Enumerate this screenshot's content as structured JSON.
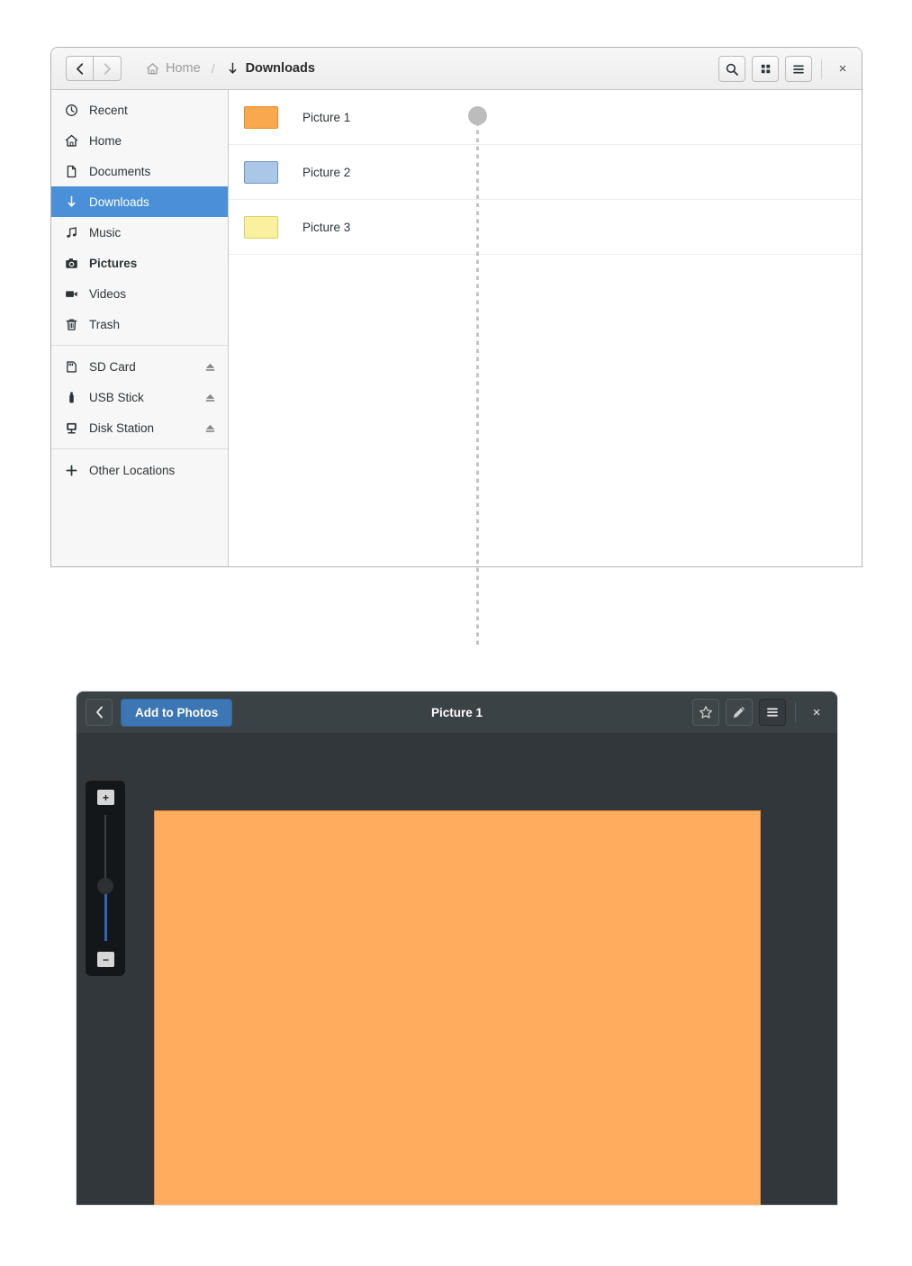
{
  "file_manager": {
    "nav": {
      "back_icon": "chevron-left-icon",
      "forward_icon": "chevron-right-icon",
      "back_label": "‹",
      "forward_label": "›"
    },
    "breadcrumb": [
      {
        "label": "Home",
        "icon": "home-icon",
        "active": false
      },
      {
        "label": "Downloads",
        "icon": "download-icon",
        "active": true
      }
    ],
    "breadcrumb_separator": "/",
    "header_buttons": [
      {
        "name": "search-button",
        "icon": "search-icon"
      },
      {
        "name": "grid-view-button",
        "icon": "grid-icon"
      },
      {
        "name": "menu-button",
        "icon": "hamburger-icon"
      }
    ],
    "close_label": "×",
    "sidebar": {
      "items": [
        {
          "label": "Recent",
          "icon": "clock-icon",
          "selected": false,
          "bold": false,
          "eject": false
        },
        {
          "label": "Home",
          "icon": "home-icon",
          "selected": false,
          "bold": false,
          "eject": false
        },
        {
          "label": "Documents",
          "icon": "document-icon",
          "selected": false,
          "bold": false,
          "eject": false
        },
        {
          "label": "Downloads",
          "icon": "download-icon",
          "selected": true,
          "bold": false,
          "eject": false
        },
        {
          "label": "Music",
          "icon": "music-note-icon",
          "selected": false,
          "bold": false,
          "eject": false
        },
        {
          "label": "Pictures",
          "icon": "camera-icon",
          "selected": false,
          "bold": true,
          "eject": false
        },
        {
          "label": "Videos",
          "icon": "video-camera-icon",
          "selected": false,
          "bold": false,
          "eject": false
        },
        {
          "label": "Trash",
          "icon": "trash-icon",
          "selected": false,
          "bold": false,
          "eject": false
        }
      ],
      "devices": [
        {
          "label": "SD Card",
          "icon": "sd-card-icon",
          "eject": true
        },
        {
          "label": "USB Stick",
          "icon": "usb-stick-icon",
          "eject": true
        },
        {
          "label": "Disk Station",
          "icon": "disk-station-icon",
          "eject": true
        }
      ],
      "other": {
        "label": "Other Locations",
        "icon": "plus-icon"
      },
      "selected_color": "#4a90d9"
    },
    "files": [
      {
        "name": "Picture 1",
        "color": "#f9a council",
        "swatch_fill": "#f9a84d",
        "swatch_border": "#e08a2a"
      },
      {
        "name": "Picture 2",
        "color": "#aac7e8",
        "swatch_fill": "#aac7e8",
        "swatch_border": "#6f93c4"
      },
      {
        "name": "Picture 3",
        "color": "#faf0a0",
        "swatch_fill": "#faf0a0",
        "swatch_border": "#dcd05a"
      }
    ]
  },
  "drag_indicator": {
    "name": "drag-handle",
    "line_color": "#c4c4c4",
    "dot_color": "#bcbcbc"
  },
  "viewer": {
    "back_label": "‹",
    "add_to_photos_label": "Add to Photos",
    "title": "Picture 1",
    "header_buttons": [
      {
        "name": "favorite-button",
        "icon": "star-icon"
      },
      {
        "name": "edit-button",
        "icon": "pencil-icon"
      },
      {
        "name": "menu-button",
        "icon": "hamburger-icon"
      }
    ],
    "close_label": "×",
    "accent_color": "#3c76b5",
    "zoom": {
      "in_label": "+",
      "out_label": "−",
      "fill_color": "#2f64b5"
    },
    "photo": {
      "name": "Picture 1",
      "fill": "#ffac5f",
      "border": "#e8883c"
    }
  }
}
